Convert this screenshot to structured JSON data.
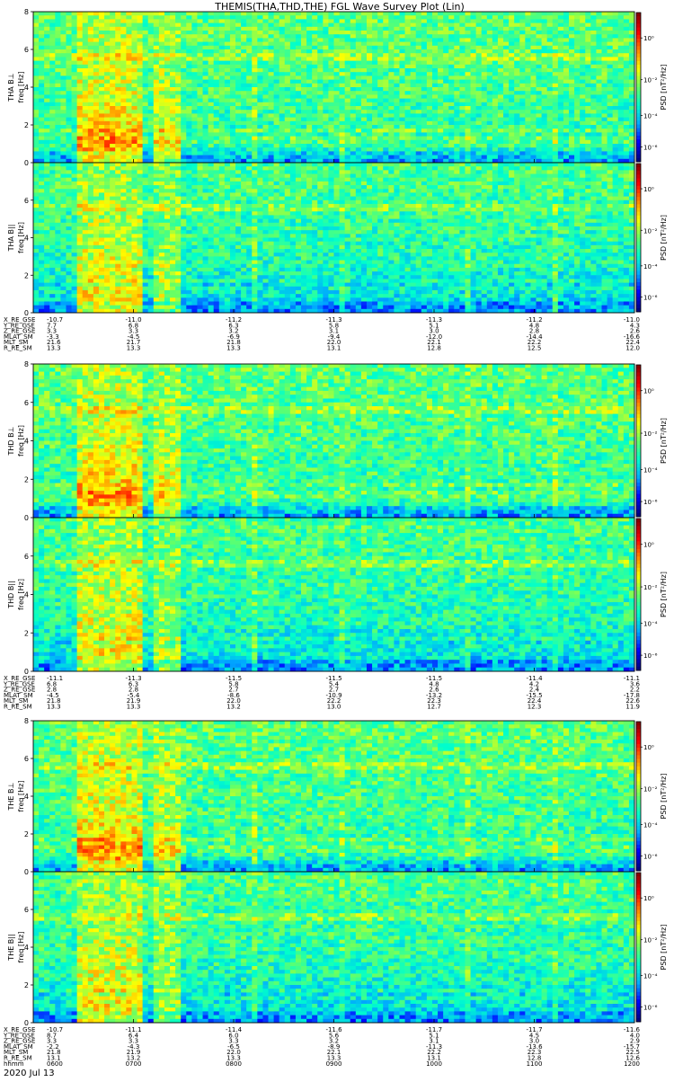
{
  "title": "THEMIS(THA,THD,THE) FGL Wave Survey Plot (Lin)",
  "footer_date": "2020 Jul 13",
  "chart_data": {
    "type": "heatmap",
    "x_axis": {
      "label": "hhmm",
      "ticks": [
        "0600",
        "0700",
        "0800",
        "0900",
        "1000",
        "1100",
        "1200"
      ]
    },
    "colorbar": {
      "label": "PSD [nT²/Hz]",
      "scale": "log",
      "tick_labels": [
        "10⁰",
        "10⁻²",
        "10⁻⁴",
        "10⁻⁶"
      ],
      "colormap": [
        "#000080",
        "#0000ff",
        "#00aaff",
        "#00ffcc",
        "#66ff66",
        "#ffff00",
        "#ff8800",
        "#ff0000",
        "#880000"
      ]
    },
    "probes": [
      {
        "panels": [
          {
            "probe": "THA",
            "component": "B⊥",
            "ylabel": "freq [Hz]",
            "ylim": [
              0,
              8
            ],
            "yticks": [
              "0",
              "2",
              "4",
              "6",
              "8"
            ],
            "cbar_ticks": [
              "10⁰",
              "10⁻²",
              "10⁻⁴",
              "10⁻⁶"
            ]
          },
          {
            "probe": "THA",
            "component": "B||",
            "ylabel": "freq [Hz]",
            "ylim": [
              0,
              8
            ],
            "yticks": [
              "0",
              "2",
              "4",
              "6"
            ],
            "cbar_ticks": [
              "10⁰",
              "10⁻²",
              "10⁻⁴",
              "10⁻⁶"
            ]
          }
        ],
        "ephemeris": [
          {
            "label": "X_RE_GSE",
            "values": [
              "-10.7",
              "-11.0",
              "-11.2",
              "-11.3",
              "-11.3",
              "-11.2",
              "-11.0"
            ]
          },
          {
            "label": "Y_RE_GSE",
            "values": [
              "7.7",
              "6.8",
              "6.3",
              "5.8",
              "5.1",
              "4.8",
              "4.3"
            ]
          },
          {
            "label": "Z_RE_GSE",
            "values": [
              "3.3",
              "3.3",
              "3.2",
              "3.1",
              "3.0",
              "2.8",
              "2.6"
            ]
          },
          {
            "label": "MLAT_SM",
            "values": [
              "-3.3",
              "-4.5",
              "-6.9",
              "-9.4",
              "-12.0",
              "-14.4",
              "-16.6"
            ]
          },
          {
            "label": "MLT_SM",
            "values": [
              "21.6",
              "21.7",
              "21.8",
              "22.0",
              "22.1",
              "22.2",
              "22.4"
            ]
          },
          {
            "label": "R_RE_SM",
            "values": [
              "13.3",
              "13.3",
              "13.3",
              "13.1",
              "12.8",
              "12.5",
              "12.0"
            ]
          }
        ]
      },
      {
        "panels": [
          {
            "probe": "THD",
            "component": "B⊥",
            "ylabel": "freq [Hz]",
            "ylim": [
              0,
              8
            ],
            "yticks": [
              "0",
              "2",
              "4",
              "6",
              "8"
            ],
            "cbar_ticks": [
              "10⁰",
              "10⁻²",
              "10⁻⁴",
              "10⁻⁶"
            ]
          },
          {
            "probe": "THD",
            "component": "B||",
            "ylabel": "freq [Hz]",
            "ylim": [
              0,
              8
            ],
            "yticks": [
              "0",
              "2",
              "4",
              "6"
            ],
            "cbar_ticks": [
              "10⁰",
              "10⁻²",
              "10⁻⁴",
              "10⁻⁶"
            ]
          }
        ],
        "ephemeris": [
          {
            "label": "X_RE_GSE",
            "values": [
              "-11.1",
              "-11.3",
              "-11.5",
              "-11.5",
              "-11.5",
              "-11.4",
              "-11.1"
            ]
          },
          {
            "label": "Y_RE_GSE",
            "values": [
              "6.8",
              "6.3",
              "5.8",
              "5.4",
              "4.8",
              "4.2",
              "3.6"
            ]
          },
          {
            "label": "Z_RE_GSE",
            "values": [
              "2.8",
              "2.8",
              "2.7",
              "2.7",
              "2.6",
              "2.4",
              "2.2"
            ]
          },
          {
            "label": "MLAT_SM",
            "values": [
              "-4.5",
              "-5.4",
              "-8.6",
              "-10.9",
              "-13.2",
              "-15.5",
              "-17.8"
            ]
          },
          {
            "label": "MLT_SM",
            "values": [
              "21.8",
              "21.9",
              "22.0",
              "22.2",
              "22.3",
              "22.4",
              "22.6"
            ]
          },
          {
            "label": "R_RE_SM",
            "values": [
              "13.3",
              "13.3",
              "13.2",
              "13.0",
              "12.7",
              "12.3",
              "11.9"
            ]
          }
        ]
      },
      {
        "panels": [
          {
            "probe": "THE",
            "component": "B⊥",
            "ylabel": "freq [Hz]",
            "ylim": [
              0,
              8
            ],
            "yticks": [
              "0",
              "2",
              "4",
              "6",
              "8"
            ],
            "cbar_ticks": [
              "10⁰",
              "10⁻²",
              "10⁻⁴",
              "10⁻⁶"
            ]
          },
          {
            "probe": "THE",
            "component": "B||",
            "ylabel": "freq [Hz]",
            "ylim": [
              0,
              8
            ],
            "yticks": [
              "0",
              "2",
              "4",
              "6"
            ],
            "cbar_ticks": [
              "10⁰",
              "10⁻²",
              "10⁻⁴",
              "10⁻⁶"
            ]
          }
        ],
        "ephemeris": [
          {
            "label": "X_RE_GSE",
            "values": [
              "-10.7",
              "-11.1",
              "-11.4",
              "-11.6",
              "-11.7",
              "-11.7",
              "-11.6"
            ]
          },
          {
            "label": "Y_RE_GSE",
            "values": [
              "8.7",
              "6.4",
              "6.0",
              "5.6",
              "5.1",
              "4.5",
              "4.0"
            ]
          },
          {
            "label": "Z_RE_GSE",
            "values": [
              "3.3",
              "3.3",
              "3.3",
              "3.2",
              "3.1",
              "3.0",
              "2.9"
            ]
          },
          {
            "label": "MLAT_SM",
            "values": [
              "-2.2",
              "-4.3",
              "-6.5",
              "-8.9",
              "-11.3",
              "-13.6",
              "-15.7"
            ]
          },
          {
            "label": "MLT_SM",
            "values": [
              "21.8",
              "21.9",
              "22.0",
              "22.1",
              "22.2",
              "22.3",
              "22.5"
            ]
          },
          {
            "label": "R_RE_SM",
            "values": [
              "13.1",
              "13.2",
              "13.3",
              "13.3",
              "13.1",
              "12.8",
              "12.6"
            ]
          }
        ],
        "time_rows": [
          {
            "label": "hhmm",
            "values": [
              "0600",
              "0700",
              "0800",
              "0900",
              "1000",
              "1100",
              "1200"
            ]
          }
        ]
      }
    ],
    "features": {
      "bursts_hours": [
        6.55,
        6.85,
        7.3,
        8.2,
        9.1,
        10.35,
        11.2
      ],
      "harmonic_lines_hz": [
        0.7,
        1.0,
        1.3,
        1.7,
        5.6
      ]
    }
  }
}
